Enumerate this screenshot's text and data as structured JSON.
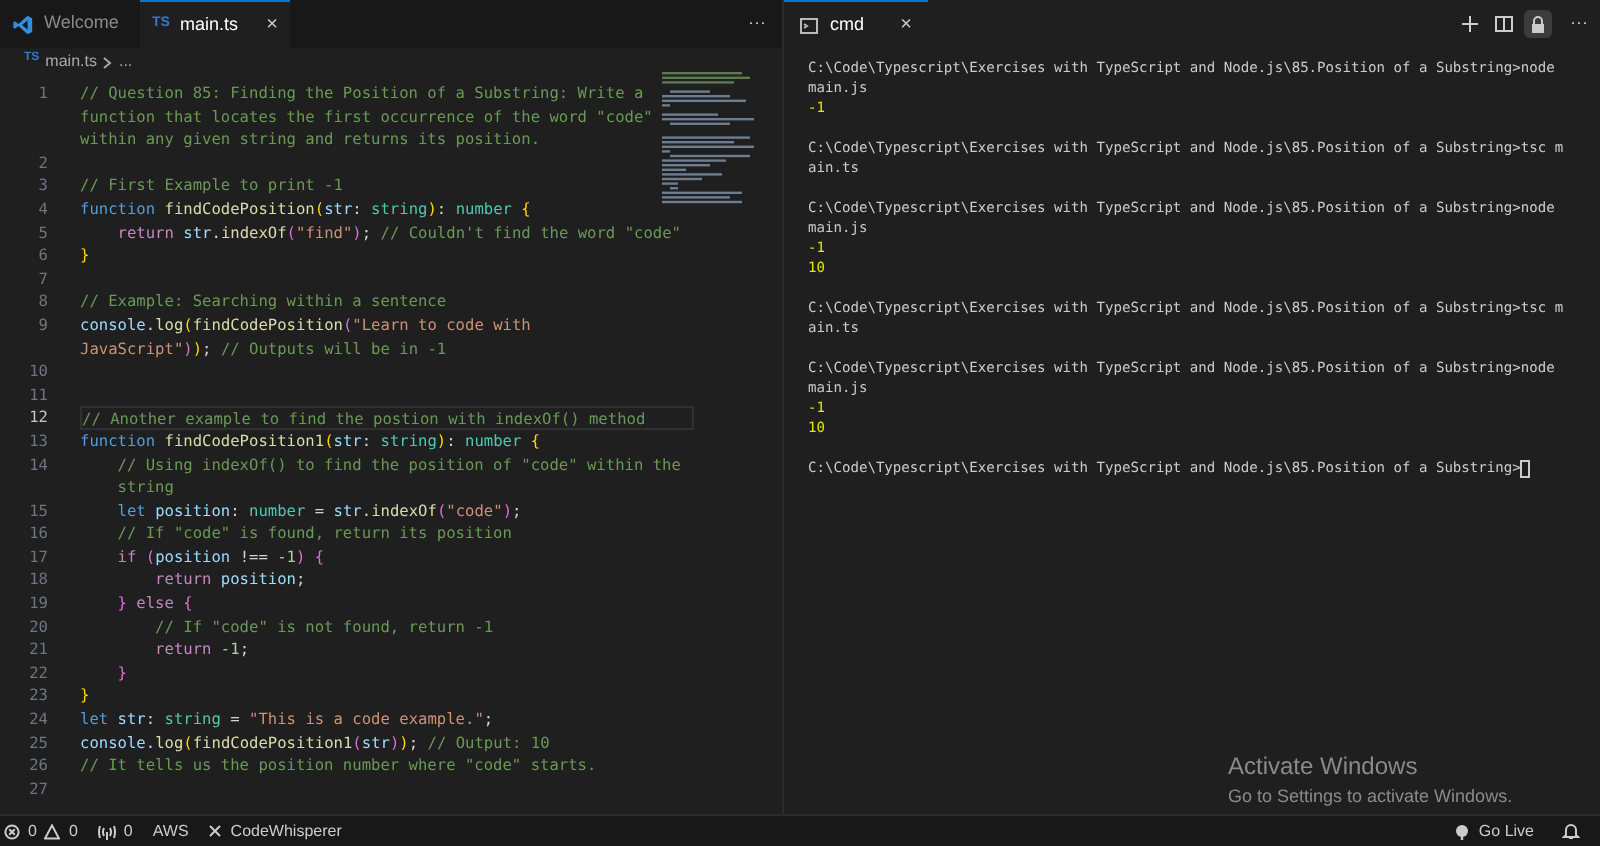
{
  "editor": {
    "tabs": [
      {
        "kind": "welcome",
        "label": "Welcome",
        "selected": false
      },
      {
        "kind": "ts",
        "badge": "TS",
        "label": "main.ts",
        "close": "×",
        "selected": true
      }
    ],
    "more": "···",
    "breadcrumb": {
      "badge": "TS",
      "file": "main.ts",
      "rest": "..."
    },
    "lines": [
      {
        "number": "1",
        "current": false,
        "rows": [
          {
            "tokens": [
              {
                "kind": "comment",
                "text": "// Question 85: Finding the Position of a Substring: Write a"
              }
            ]
          },
          {
            "tokens": [
              {
                "kind": "comment",
                "text": "function that locates the first occurrence of the word \"code\""
              }
            ]
          },
          {
            "tokens": [
              {
                "kind": "comment",
                "text": "within any given string and returns its position."
              }
            ]
          }
        ]
      },
      {
        "number": "2",
        "current": false
      },
      {
        "number": "3",
        "current": false,
        "rows": [
          {
            "tokens": [
              {
                "kind": "comment",
                "text": "// First Example to print -1"
              }
            ]
          }
        ]
      },
      {
        "number": "4",
        "current": false,
        "rows": [
          {
            "tokens": [
              {
                "kind": "keyword",
                "text": "function "
              },
              {
                "kind": "fn",
                "text": "findCodePosition"
              },
              {
                "kind": "bracket",
                "text": "("
              },
              {
                "kind": "var",
                "text": "str"
              },
              {
                "kind": "plain",
                "text": ": "
              },
              {
                "kind": "type",
                "text": "string"
              },
              {
                "kind": "bracket",
                "text": ")"
              },
              {
                "kind": "plain",
                "text": ": "
              },
              {
                "kind": "type",
                "text": "number "
              },
              {
                "kind": "bracket",
                "text": "{"
              }
            ]
          }
        ]
      },
      {
        "number": "5",
        "current": false,
        "rows": [
          {
            "tokens": [
              {
                "kind": "control",
                "text": "    return "
              },
              {
                "kind": "var",
                "text": "str"
              },
              {
                "kind": "plain",
                "text": "."
              },
              {
                "kind": "fn",
                "text": "indexOf"
              },
              {
                "kind": "bracket2",
                "text": "("
              },
              {
                "kind": "string",
                "text": "\"find\""
              },
              {
                "kind": "bracket2",
                "text": ")"
              },
              {
                "kind": "plain",
                "text": "; "
              },
              {
                "kind": "comment",
                "text": "// Couldn't find the word \"code\""
              }
            ]
          }
        ]
      },
      {
        "number": "6",
        "current": false,
        "rows": [
          {
            "tokens": [
              {
                "kind": "bracket",
                "text": "}"
              }
            ]
          }
        ]
      },
      {
        "number": "7",
        "current": false
      },
      {
        "number": "8",
        "current": false,
        "rows": [
          {
            "tokens": [
              {
                "kind": "comment",
                "text": "// Example: Searching within a sentence"
              }
            ]
          }
        ]
      },
      {
        "number": "9",
        "current": false,
        "rows": [
          {
            "tokens": [
              {
                "kind": "var",
                "text": "console"
              },
              {
                "kind": "plain",
                "text": "."
              },
              {
                "kind": "fn",
                "text": "log"
              },
              {
                "kind": "bracket",
                "text": "("
              },
              {
                "kind": "fn",
                "text": "findCodePosition"
              },
              {
                "kind": "bracket2",
                "text": "("
              },
              {
                "kind": "string",
                "text": "\"Learn to code with"
              }
            ]
          },
          {
            "tokens": [
              {
                "kind": "string",
                "text": "JavaScript\""
              },
              {
                "kind": "bracket2",
                "text": ")"
              },
              {
                "kind": "bracket",
                "text": ")"
              },
              {
                "kind": "plain",
                "text": "; "
              },
              {
                "kind": "comment",
                "text": "// Outputs will be in -1"
              }
            ]
          }
        ]
      },
      {
        "number": "10",
        "current": false
      },
      {
        "number": "11",
        "current": false
      },
      {
        "number": "12",
        "current": true,
        "rows": [
          {
            "tokens": [
              {
                "kind": "comment",
                "text": "// Another example to find the postion with indexOf() method"
              }
            ]
          }
        ]
      },
      {
        "number": "13",
        "current": false,
        "rows": [
          {
            "tokens": [
              {
                "kind": "keyword",
                "text": "function "
              },
              {
                "kind": "fn",
                "text": "findCodePosition1"
              },
              {
                "kind": "bracket",
                "text": "("
              },
              {
                "kind": "var",
                "text": "str"
              },
              {
                "kind": "plain",
                "text": ": "
              },
              {
                "kind": "type",
                "text": "string"
              },
              {
                "kind": "bracket",
                "text": ")"
              },
              {
                "kind": "plain",
                "text": ": "
              },
              {
                "kind": "type",
                "text": "number "
              },
              {
                "kind": "bracket",
                "text": "{"
              }
            ]
          }
        ]
      },
      {
        "number": "14",
        "current": false,
        "rows": [
          {
            "tokens": [
              {
                "kind": "comment",
                "text": "    // Using indexOf() to find the position of \"code\" within the"
              }
            ]
          },
          {
            "tokens": [
              {
                "kind": "comment",
                "text": "    string"
              }
            ]
          }
        ]
      },
      {
        "number": "15",
        "current": false,
        "rows": [
          {
            "tokens": [
              {
                "kind": "keyword",
                "text": "    let "
              },
              {
                "kind": "var",
                "text": "position"
              },
              {
                "kind": "plain",
                "text": ": "
              },
              {
                "kind": "type",
                "text": "number"
              },
              {
                "kind": "plain",
                "text": " = "
              },
              {
                "kind": "var",
                "text": "str"
              },
              {
                "kind": "plain",
                "text": "."
              },
              {
                "kind": "fn",
                "text": "indexOf"
              },
              {
                "kind": "bracket2",
                "text": "("
              },
              {
                "kind": "string",
                "text": "\"code\""
              },
              {
                "kind": "bracket2",
                "text": ")"
              },
              {
                "kind": "plain",
                "text": ";"
              }
            ]
          }
        ]
      },
      {
        "number": "16",
        "current": false,
        "rows": [
          {
            "tokens": [
              {
                "kind": "comment",
                "text": "    // If \"code\" is found, return its position"
              }
            ]
          }
        ]
      },
      {
        "number": "17",
        "current": false,
        "rows": [
          {
            "tokens": [
              {
                "kind": "control",
                "text": "    if "
              },
              {
                "kind": "bracket2",
                "text": "("
              },
              {
                "kind": "var",
                "text": "position"
              },
              {
                "kind": "plain",
                "text": " !== "
              },
              {
                "kind": "number",
                "text": "-1"
              },
              {
                "kind": "bracket2",
                "text": ") {"
              }
            ]
          }
        ]
      },
      {
        "number": "18",
        "current": false,
        "rows": [
          {
            "tokens": [
              {
                "kind": "control",
                "text": "        return "
              },
              {
                "kind": "var",
                "text": "position"
              },
              {
                "kind": "plain",
                "text": ";"
              }
            ]
          }
        ]
      },
      {
        "number": "19",
        "current": false,
        "rows": [
          {
            "tokens": [
              {
                "kind": "bracket2",
                "text": "    } "
              },
              {
                "kind": "control",
                "text": "else "
              },
              {
                "kind": "bracket2",
                "text": "{"
              }
            ]
          }
        ]
      },
      {
        "number": "20",
        "current": false,
        "rows": [
          {
            "tokens": [
              {
                "kind": "comment",
                "text": "        // If \"code\" is not found, return -1"
              }
            ]
          }
        ]
      },
      {
        "number": "21",
        "current": false,
        "rows": [
          {
            "tokens": [
              {
                "kind": "control",
                "text": "        return "
              },
              {
                "kind": "number",
                "text": "-1"
              },
              {
                "kind": "plain",
                "text": ";"
              }
            ]
          }
        ]
      },
      {
        "number": "22",
        "current": false,
        "rows": [
          {
            "tokens": [
              {
                "kind": "bracket2",
                "text": "    }"
              }
            ]
          }
        ]
      },
      {
        "number": "23",
        "current": false,
        "rows": [
          {
            "tokens": [
              {
                "kind": "bracket",
                "text": "}"
              }
            ]
          }
        ]
      },
      {
        "number": "24",
        "current": false,
        "rows": [
          {
            "tokens": [
              {
                "kind": "keyword",
                "text": "let "
              },
              {
                "kind": "var",
                "text": "str"
              },
              {
                "kind": "plain",
                "text": ": "
              },
              {
                "kind": "type",
                "text": "string"
              },
              {
                "kind": "plain",
                "text": " = "
              },
              {
                "kind": "string",
                "text": "\"This is a code example.\""
              },
              {
                "kind": "plain",
                "text": ";"
              }
            ]
          }
        ]
      },
      {
        "number": "25",
        "current": false,
        "rows": [
          {
            "tokens": [
              {
                "kind": "var",
                "text": "console"
              },
              {
                "kind": "plain",
                "text": "."
              },
              {
                "kind": "fn",
                "text": "log"
              },
              {
                "kind": "bracket",
                "text": "("
              },
              {
                "kind": "fn",
                "text": "findCodePosition1"
              },
              {
                "kind": "bracket2",
                "text": "("
              },
              {
                "kind": "var",
                "text": "str"
              },
              {
                "kind": "bracket2",
                "text": ")"
              },
              {
                "kind": "bracket",
                "text": ")"
              },
              {
                "kind": "plain",
                "text": "; "
              },
              {
                "kind": "comment",
                "text": "// Output: 10"
              }
            ]
          }
        ]
      },
      {
        "number": "26",
        "current": false,
        "rows": [
          {
            "tokens": [
              {
                "kind": "comment",
                "text": "// It tells us the position number where \"code\" starts."
              }
            ]
          }
        ]
      },
      {
        "number": "27",
        "current": false
      }
    ]
  },
  "terminal": {
    "tab": {
      "label": "cmd",
      "close": "×"
    },
    "more": "···",
    "blocks": [
      [
        {
          "kind": "prompt",
          "text": "C:\\Code\\Typescript\\Exercises with TypeScript and Node.js\\85.Position of a Substring>node"
        },
        {
          "kind": "prompt",
          "text": "main.js"
        },
        {
          "kind": "output",
          "text": "-1"
        }
      ],
      [
        {
          "kind": "prompt",
          "text": "C:\\Code\\Typescript\\Exercises with TypeScript and Node.js\\85.Position of a Substring>tsc m"
        },
        {
          "kind": "prompt",
          "text": "ain.ts"
        }
      ],
      [
        {
          "kind": "prompt",
          "text": "C:\\Code\\Typescript\\Exercises with TypeScript and Node.js\\85.Position of a Substring>node"
        },
        {
          "kind": "prompt",
          "text": "main.js"
        },
        {
          "kind": "output",
          "text": "-1"
        },
        {
          "kind": "output",
          "text": "10"
        }
      ],
      [
        {
          "kind": "prompt",
          "text": "C:\\Code\\Typescript\\Exercises with TypeScript and Node.js\\85.Position of a Substring>tsc m"
        },
        {
          "kind": "prompt",
          "text": "ain.ts"
        }
      ],
      [
        {
          "kind": "prompt",
          "text": "C:\\Code\\Typescript\\Exercises with TypeScript and Node.js\\85.Position of a Substring>node"
        },
        {
          "kind": "prompt",
          "text": "main.js"
        },
        {
          "kind": "output",
          "text": "-1"
        },
        {
          "kind": "output",
          "text": "10"
        }
      ],
      [
        {
          "kind": "cursor",
          "text": "C:\\Code\\Typescript\\Exercises with TypeScript and Node.js\\85.Position of a Substring>"
        }
      ]
    ]
  },
  "activation": {
    "title": "Activate Windows",
    "subtitle": "Go to Settings to activate Windows."
  },
  "status_bar": {
    "errors": "0",
    "warnings": "0",
    "ports": "0",
    "aws": "AWS",
    "codewhisperer": "CodeWhisperer",
    "go_live": "Go Live"
  }
}
